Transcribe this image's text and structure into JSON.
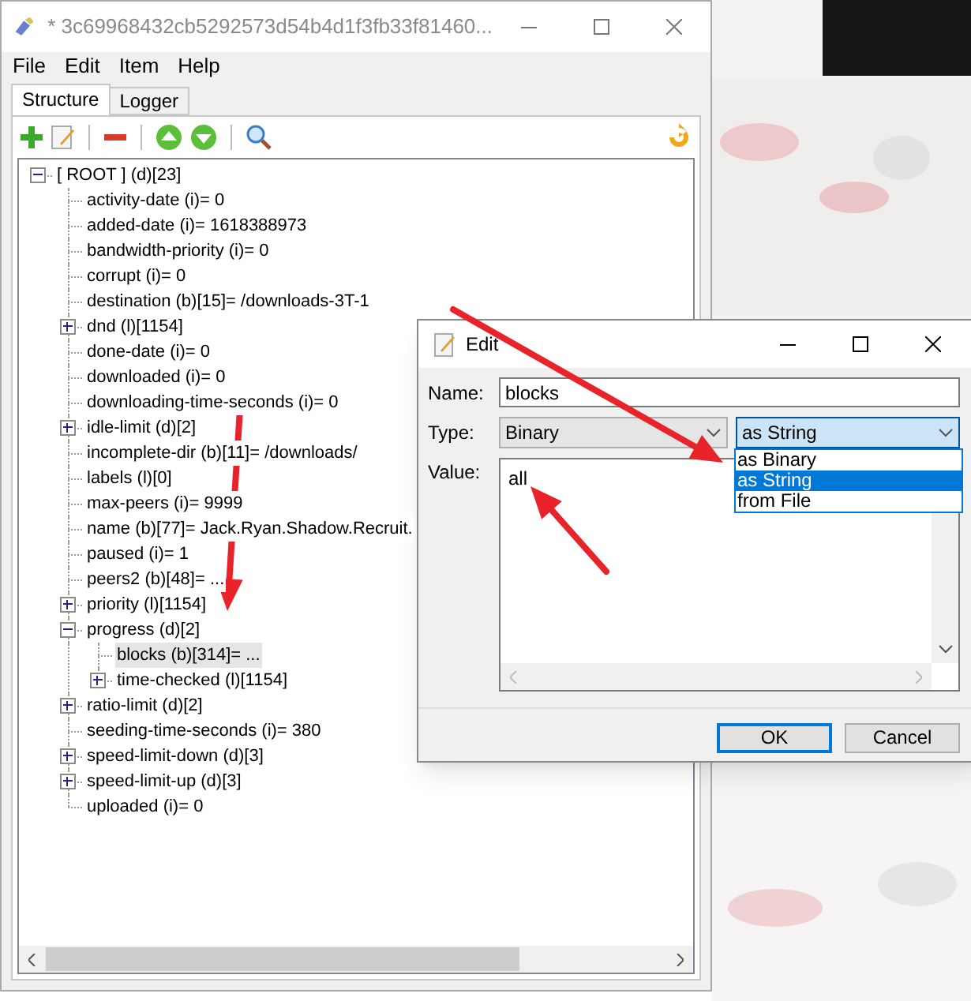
{
  "window": {
    "title": "* 3c69968432cb5292573d54b4d1f3fb33f81460..."
  },
  "menu": [
    "File",
    "Edit",
    "Item",
    "Help"
  ],
  "tabs": [
    {
      "label": "Structure",
      "selected": true
    },
    {
      "label": "Logger",
      "selected": false
    }
  ],
  "tree": [
    {
      "label": "[ ROOT ] (d)[23]",
      "selected": false,
      "expanded": true,
      "children": [
        {
          "label": "activity-date (i)= 0",
          "selected": false
        },
        {
          "label": "added-date (i)= 1618388973",
          "selected": false
        },
        {
          "label": "bandwidth-priority (i)= 0",
          "selected": false
        },
        {
          "label": "corrupt (i)= 0",
          "selected": false
        },
        {
          "label": "destination (b)[15]= /downloads-3T-1",
          "selected": false
        },
        {
          "label": "dnd (l)[1154]",
          "selected": false,
          "expanded": false
        },
        {
          "label": "done-date (i)= 0",
          "selected": false
        },
        {
          "label": "downloaded (i)= 0",
          "selected": false
        },
        {
          "label": "downloading-time-seconds (i)= 0",
          "selected": false
        },
        {
          "label": "idle-limit (d)[2]",
          "selected": false,
          "expanded": false
        },
        {
          "label": "incomplete-dir (b)[11]= /downloads/",
          "selected": false
        },
        {
          "label": "labels (l)[0]",
          "selected": false
        },
        {
          "label": "max-peers (i)= 9999",
          "selected": false
        },
        {
          "label": "name (b)[77]= Jack.Ryan.Shadow.Recruit.",
          "selected": false
        },
        {
          "label": "paused (i)= 1",
          "selected": false
        },
        {
          "label": "peers2 (b)[48]= ...",
          "selected": false
        },
        {
          "label": "priority (l)[1154]",
          "selected": false,
          "expanded": false
        },
        {
          "label": "progress (d)[2]",
          "selected": false,
          "expanded": true,
          "children": [
            {
              "label": "blocks (b)[314]= ...",
              "selected": true
            },
            {
              "label": "time-checked (l)[1154]",
              "selected": false,
              "expanded": false
            }
          ]
        },
        {
          "label": "ratio-limit (d)[2]",
          "selected": false,
          "expanded": false
        },
        {
          "label": "seeding-time-seconds (i)= 380",
          "selected": false
        },
        {
          "label": "speed-limit-down (d)[3]",
          "selected": false,
          "expanded": false
        },
        {
          "label": "speed-limit-up (d)[3]",
          "selected": false,
          "expanded": false
        },
        {
          "label": "uploaded (i)= 0",
          "selected": false
        }
      ]
    }
  ],
  "dialog": {
    "title": "Edit",
    "name_label": "Name:",
    "name_value": "blocks",
    "type_label": "Type:",
    "type_value": "Binary",
    "format_value": "as String",
    "format_options": [
      {
        "label": "as Binary",
        "selected": false
      },
      {
        "label": "as String",
        "selected": true
      },
      {
        "label": "from File",
        "selected": false
      }
    ],
    "value_label": "Value:",
    "value": "all",
    "buttons": [
      {
        "label": "OK",
        "default": true
      },
      {
        "label": "Cancel",
        "default": false
      }
    ]
  }
}
